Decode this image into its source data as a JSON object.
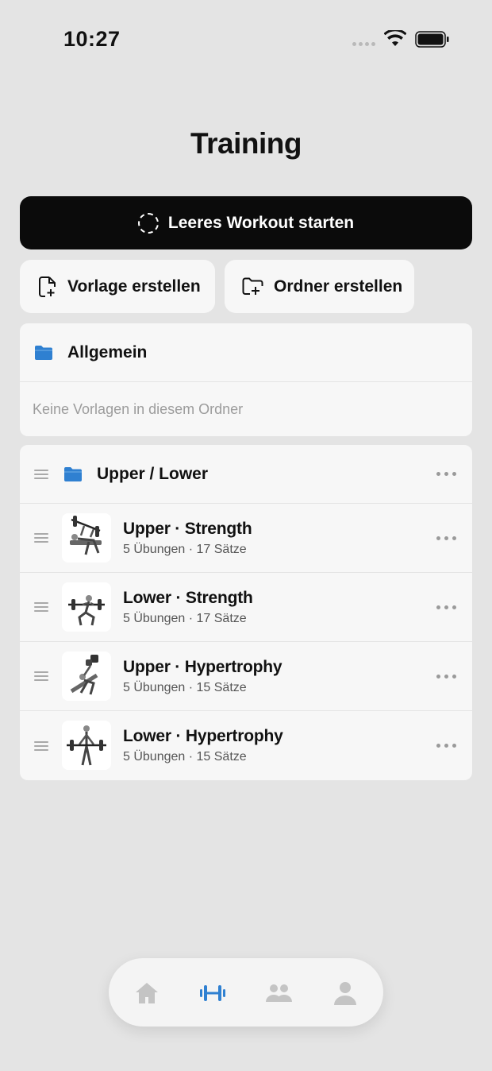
{
  "status_bar": {
    "time": "10:27"
  },
  "page": {
    "title": "Training"
  },
  "actions": {
    "start_workout": "Leeres Workout starten",
    "create_template": "Vorlage erstellen",
    "create_folder": "Ordner erstellen"
  },
  "folders": [
    {
      "name": "Allgemein",
      "empty_text": "Keine Vorlagen in diesem Ordner",
      "icon": "folder-icon"
    },
    {
      "name": "Upper / Lower",
      "icon": "folder-icon",
      "templates": [
        {
          "title": "Upper · Strength",
          "subtitle": "5 Übungen · 17 Sätze"
        },
        {
          "title": "Lower · Strength",
          "subtitle": "5 Übungen · 17 Sätze"
        },
        {
          "title": "Upper · Hypertrophy",
          "subtitle": "5 Übungen · 15 Sätze"
        },
        {
          "title": "Lower · Hypertrophy",
          "subtitle": "5 Übungen · 15 Sätze"
        }
      ]
    }
  ],
  "tab_bar": {
    "tabs": [
      {
        "icon": "home-icon",
        "active": false
      },
      {
        "icon": "dumbbell-icon",
        "active": true
      },
      {
        "icon": "people-icon",
        "active": false
      },
      {
        "icon": "profile-icon",
        "active": false
      }
    ]
  },
  "colors": {
    "accent": "#2f80d1",
    "folder": "#2f80d1",
    "inactive_tab": "#c4c4c4",
    "primary_button": "#0b0b0b"
  }
}
